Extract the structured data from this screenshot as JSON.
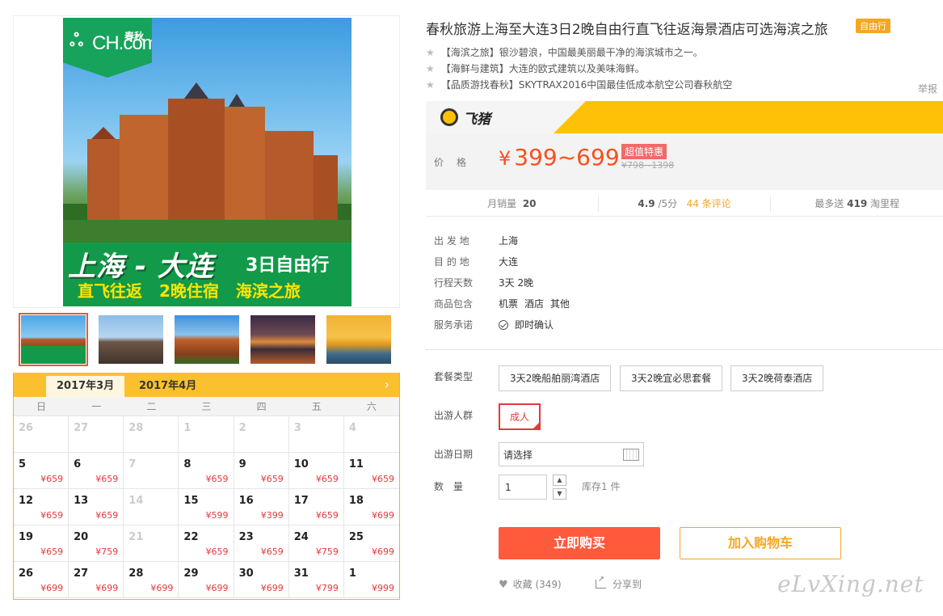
{
  "poster": {
    "logo_text": "CH.com",
    "logo_cn": "春秋",
    "title_main": "上海 - 大连",
    "title_side": "3日自由行",
    "subline": "直飞往返 2晚住宿 海滨之旅"
  },
  "calendar": {
    "tabs": [
      "2017年3月",
      "2017年4月"
    ],
    "weekdays": [
      "日",
      "一",
      "二",
      "三",
      "四",
      "五",
      "六"
    ],
    "days": [
      {
        "day": "26",
        "price": "",
        "muted": true
      },
      {
        "day": "27",
        "price": "",
        "muted": true
      },
      {
        "day": "28",
        "price": "",
        "muted": true
      },
      {
        "day": "1",
        "price": "",
        "muted": true
      },
      {
        "day": "2",
        "price": "",
        "muted": true
      },
      {
        "day": "3",
        "price": "",
        "muted": true
      },
      {
        "day": "4",
        "price": "",
        "muted": true
      },
      {
        "day": "5",
        "price": "¥659",
        "muted": false
      },
      {
        "day": "6",
        "price": "¥659",
        "muted": false
      },
      {
        "day": "7",
        "price": "",
        "muted": true
      },
      {
        "day": "8",
        "price": "¥659",
        "muted": false
      },
      {
        "day": "9",
        "price": "¥659",
        "muted": false
      },
      {
        "day": "10",
        "price": "¥659",
        "muted": false
      },
      {
        "day": "11",
        "price": "¥659",
        "muted": false
      },
      {
        "day": "12",
        "price": "¥659",
        "muted": false
      },
      {
        "day": "13",
        "price": "¥659",
        "muted": false
      },
      {
        "day": "14",
        "price": "",
        "muted": true
      },
      {
        "day": "15",
        "price": "¥599",
        "muted": false
      },
      {
        "day": "16",
        "price": "¥399",
        "muted": false
      },
      {
        "day": "17",
        "price": "¥659",
        "muted": false
      },
      {
        "day": "18",
        "price": "¥699",
        "muted": false
      },
      {
        "day": "19",
        "price": "¥659",
        "muted": false
      },
      {
        "day": "20",
        "price": "¥759",
        "muted": false
      },
      {
        "day": "21",
        "price": "",
        "muted": true
      },
      {
        "day": "22",
        "price": "¥659",
        "muted": false
      },
      {
        "day": "23",
        "price": "¥659",
        "muted": false
      },
      {
        "day": "24",
        "price": "¥759",
        "muted": false
      },
      {
        "day": "25",
        "price": "¥699",
        "muted": false
      },
      {
        "day": "26",
        "price": "¥699",
        "muted": false
      },
      {
        "day": "27",
        "price": "¥699",
        "muted": false
      },
      {
        "day": "28",
        "price": "¥699",
        "muted": false
      },
      {
        "day": "29",
        "price": "¥699",
        "muted": false
      },
      {
        "day": "30",
        "price": "¥699",
        "muted": false
      },
      {
        "day": "31",
        "price": "¥799",
        "muted": false
      },
      {
        "day": "1",
        "price": "¥999",
        "muted": false
      }
    ]
  },
  "product": {
    "title": "春秋旅游上海至大连3日2晚自由行直飞往返海景酒店可选海滨之旅",
    "badge": "自由行",
    "highlights": [
      "【海滨之旅】银沙碧浪，中国最美丽最干净的海滨城市之一。",
      "【海鲜与建筑】大连的欧式建筑以及美味海鲜。",
      "【品质游找春秋】SKYTRAX2016中国最佳低成本航空公司春秋航空"
    ],
    "report": "举报"
  },
  "brand": {
    "name": "飞猪"
  },
  "price": {
    "label": "价格",
    "value": "399~699",
    "currency": "¥",
    "tag": "超值特惠",
    "original": "¥798~1398"
  },
  "stats": {
    "sales_label": "月销量",
    "sales": "20",
    "rating": "4.9",
    "rating_suffix": "/5分",
    "reviews": "44 条评论",
    "miles_prefix": "最多送",
    "miles": "419",
    "miles_suffix": "淘里程"
  },
  "info": {
    "rows": [
      {
        "k": "出 发 地",
        "v": "上海"
      },
      {
        "k": "目 的 地",
        "v": "大连"
      },
      {
        "k": "行程天数",
        "v": "3天 2晚"
      }
    ],
    "includes_label": "商品包含",
    "includes": [
      "机票",
      "酒店",
      "其他"
    ],
    "service_label": "服务承诺",
    "service": "即时确认"
  },
  "options": {
    "package_label": "套餐类型",
    "packages": [
      "3天2晚船舶丽湾酒店",
      "3天2晚宜必思套餐",
      "3天2晚荷泰酒店"
    ],
    "people_label": "出游人群",
    "people": "成人",
    "date_label": "出游日期",
    "date_placeholder": "请选择",
    "qty_label": "数　量",
    "qty": "1",
    "stock": "库存1 件"
  },
  "actions": {
    "buy": "立即购买",
    "cart": "加入购物车",
    "fav": "收藏 (349)",
    "share": "分享到"
  },
  "watermark": "eLvXing.net"
}
